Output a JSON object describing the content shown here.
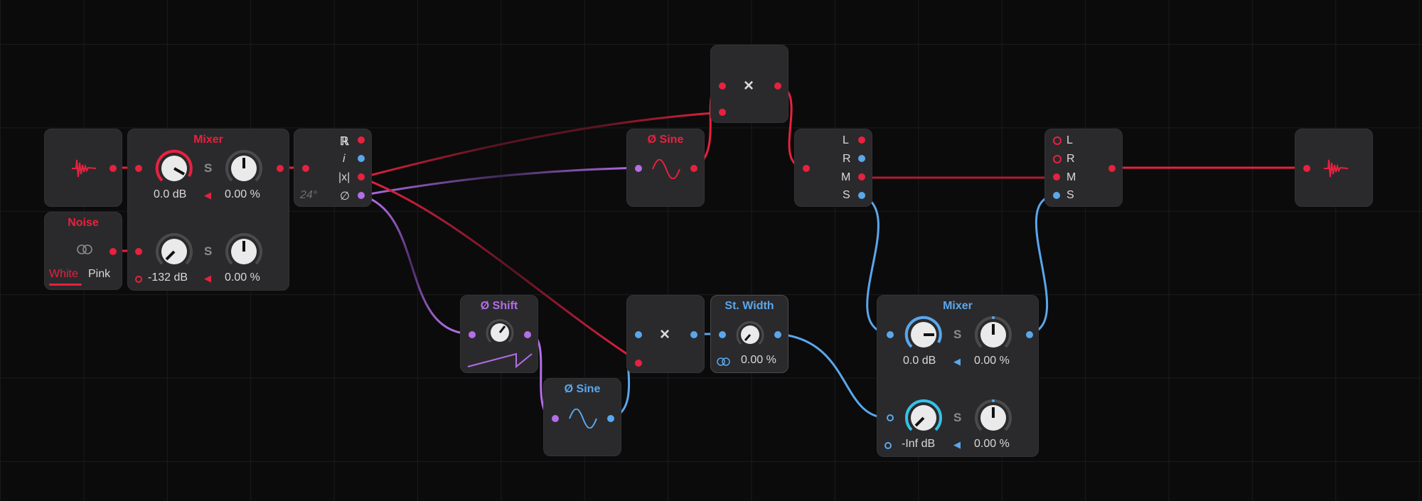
{
  "colors": {
    "red": "#e8213f",
    "blue": "#5aa7ec",
    "purple": "#b46ee6",
    "module_bg": "#2a2a2c",
    "canvas_bg": "#0b0b0c"
  },
  "input_module": {
    "icon": "audio-input-waveform-icon"
  },
  "noise": {
    "title": "Noise",
    "options": [
      "White",
      "Pink"
    ],
    "selected": "White"
  },
  "mixer_top": {
    "title": "Mixer",
    "ch1": {
      "gain": "0.0 dB",
      "width": "0.00 %",
      "gain_level": 0.82
    },
    "ch2": {
      "gain": "-132 dB",
      "width": "0.00 %",
      "gain_level": 0.0
    },
    "solo_label": "S"
  },
  "complex": {
    "ports": [
      "ℝ",
      "i",
      "|x|",
      "∅"
    ],
    "angle": "24°"
  },
  "sine_top": {
    "title": "Ø Sine"
  },
  "multiply_top": {
    "symbol": "×"
  },
  "lrms_left": {
    "ports": [
      "L",
      "R",
      "M",
      "S"
    ]
  },
  "lrms_right": {
    "ports": [
      "L",
      "R",
      "M",
      "S"
    ]
  },
  "output_module": {
    "icon": "audio-output-waveform-icon"
  },
  "phase_shift": {
    "title": "Ø Shift"
  },
  "sine_bottom": {
    "title": "Ø Sine"
  },
  "multiply_bottom": {
    "symbol": "×"
  },
  "stereo_width": {
    "title": "St. Width",
    "value": "0.00 %"
  },
  "mixer_bottom": {
    "title": "Mixer",
    "ch1": {
      "gain": "0.0 dB",
      "width": "0.00 %",
      "gain_level": 0.82
    },
    "ch2": {
      "gain": "-Inf dB",
      "width": "0.00 %",
      "gain_level": 0.0
    },
    "solo_label": "S"
  }
}
